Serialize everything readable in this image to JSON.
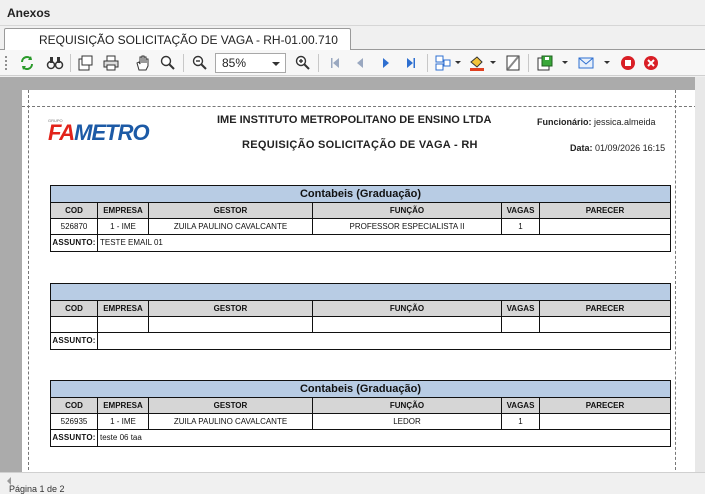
{
  "window": {
    "title": "Anexos"
  },
  "tab": {
    "label": "REQUISIÇÃO SOLICITAÇÃO DE VAGA - RH-01.00.710"
  },
  "toolbar": {
    "zoom_value": "85%"
  },
  "report": {
    "company": "IME INSTITUTO METROPOLITANO DE ENSINO LTDA",
    "title": "REQUISIÇÃO SOLICITAÇÃO DE VAGA - RH",
    "employee_label": "Funcionário:",
    "employee_value": "jessica.almeida",
    "date_label": "Data:",
    "date_value": "01/09/2026 16:15",
    "logo": {
      "tag": "GRUPO",
      "part1": "FA",
      "part2": "METRO"
    }
  },
  "columns": [
    "COD",
    "EMPRESA",
    "GESTOR",
    "FUNÇÃO",
    "VAGAS",
    "PARECER"
  ],
  "subject_label": "ASSUNTO:",
  "blocks": [
    {
      "title": "Contabeis (Graduação)",
      "cod": "526870",
      "empresa": "1 - IME",
      "gestor": "ZUILA PAULINO CAVALCANTE",
      "funcao": "PROFESSOR ESPECIALISTA II",
      "vagas": "1",
      "parecer": "",
      "assunto": "TESTE EMAIL 01"
    },
    {
      "title": "",
      "cod": "",
      "empresa": "",
      "gestor": "",
      "funcao": "",
      "vagas": "",
      "parecer": "",
      "assunto": ""
    },
    {
      "title": "Contabeis (Graduação)",
      "cod": "526935",
      "empresa": "1 - IME",
      "gestor": "ZUILA PAULINO CAVALCANTE",
      "funcao": "LEDOR",
      "vagas": "1",
      "parecer": "",
      "assunto": "teste 06 taa"
    }
  ],
  "status_bar": {
    "text": "Página 1 de 2"
  },
  "colors": {
    "header_blue": "#b8cce4",
    "col_header_grey": "#d6d6d6",
    "logo_red": "#e2231a",
    "logo_blue": "#1c5aa6"
  },
  "icons": [
    "refresh-icon",
    "find-icon",
    "page-setup-icon",
    "print-icon",
    "hand-icon",
    "zoom-tool-icon",
    "zoom-out-icon",
    "zoom-in-icon",
    "first-page-icon",
    "prev-page-icon",
    "next-page-icon",
    "last-page-icon",
    "view-mode-icon",
    "background-color-icon",
    "watermark-icon",
    "export-icon",
    "email-icon",
    "stop-icon",
    "close-icon"
  ]
}
